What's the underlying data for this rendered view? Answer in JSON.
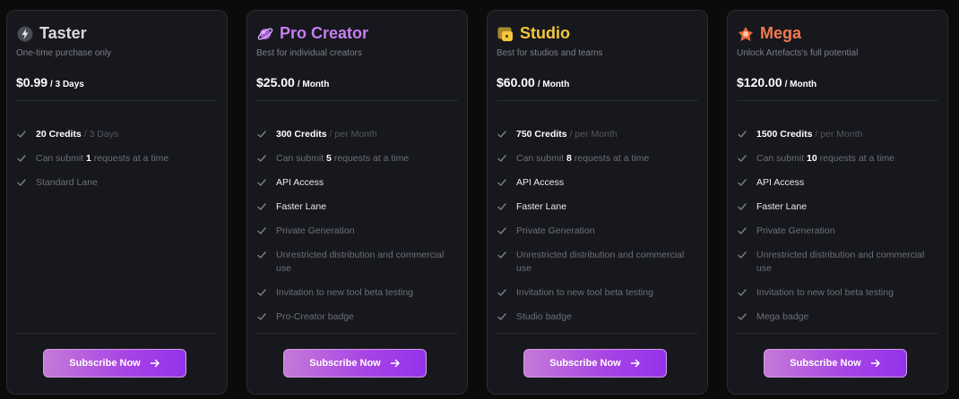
{
  "plans": [
    {
      "name": "Taster",
      "color": "#d8d9dd",
      "icon": "lightning-icon",
      "subtitle": "One-time purchase only",
      "price": "$0.99",
      "period": "/ 3 Days",
      "cta": "Subscribe Now",
      "features": [
        {
          "pre": "",
          "strong": "20 Credits",
          "post": "",
          "muted": " / 3 Days",
          "bright": true
        },
        {
          "pre": "Can submit ",
          "strong": "1",
          "post": " requests at a time",
          "muted": "",
          "bright": false
        },
        {
          "pre": "Standard Lane",
          "strong": "",
          "post": "",
          "muted": "",
          "bright": false
        }
      ]
    },
    {
      "name": "Pro Creator",
      "color": "#c77df0",
      "icon": "planet-icon",
      "subtitle": "Best for individual creators",
      "price": "$25.00",
      "period": "/ Month",
      "cta": "Subscribe Now",
      "features": [
        {
          "pre": "",
          "strong": "300 Credits",
          "post": "",
          "muted": " / per Month",
          "bright": true
        },
        {
          "pre": "Can submit ",
          "strong": "5",
          "post": " requests at a time",
          "muted": "",
          "bright": false
        },
        {
          "pre": "API Access",
          "strong": "",
          "post": "",
          "muted": "",
          "bright": true
        },
        {
          "pre": "Faster Lane",
          "strong": "",
          "post": "",
          "muted": "",
          "bright": true
        },
        {
          "pre": "Private Generation",
          "strong": "",
          "post": "",
          "muted": "",
          "bright": false
        },
        {
          "pre": "Unrestricted distribution and commercial use",
          "strong": "",
          "post": "",
          "muted": "",
          "bright": false
        },
        {
          "pre": "Invitation to new tool beta testing",
          "strong": "",
          "post": "",
          "muted": "",
          "bright": false
        },
        {
          "pre": "Pro-Creator badge",
          "strong": "",
          "post": "",
          "muted": "",
          "bright": false
        }
      ]
    },
    {
      "name": "Studio",
      "color": "#f5c73b",
      "icon": "studio-icon",
      "subtitle": "Best for studios and teams",
      "price": "$60.00",
      "period": "/ Month",
      "cta": "Subscribe Now",
      "features": [
        {
          "pre": "",
          "strong": "750 Credits",
          "post": "",
          "muted": " / per Month",
          "bright": true
        },
        {
          "pre": "Can submit ",
          "strong": "8",
          "post": " requests at a time",
          "muted": "",
          "bright": false
        },
        {
          "pre": "API Access",
          "strong": "",
          "post": "",
          "muted": "",
          "bright": true
        },
        {
          "pre": "Faster Lane",
          "strong": "",
          "post": "",
          "muted": "",
          "bright": true
        },
        {
          "pre": "Private Generation",
          "strong": "",
          "post": "",
          "muted": "",
          "bright": false
        },
        {
          "pre": "Unrestricted distribution and commercial use",
          "strong": "",
          "post": "",
          "muted": "",
          "bright": false
        },
        {
          "pre": "Invitation to new tool beta testing",
          "strong": "",
          "post": "",
          "muted": "",
          "bright": false
        },
        {
          "pre": "Studio badge",
          "strong": "",
          "post": "",
          "muted": "",
          "bright": false
        }
      ]
    },
    {
      "name": "Mega",
      "color": "#f47a4e",
      "icon": "mega-icon",
      "subtitle": "Unlock Artefacts's full potential",
      "price": "$120.00",
      "period": "/ Month",
      "cta": "Subscribe Now",
      "features": [
        {
          "pre": "",
          "strong": "1500 Credits",
          "post": "",
          "muted": " / per Month",
          "bright": true
        },
        {
          "pre": "Can submit ",
          "strong": "10",
          "post": " requests at a time",
          "muted": "",
          "bright": false
        },
        {
          "pre": "API Access",
          "strong": "",
          "post": "",
          "muted": "",
          "bright": true
        },
        {
          "pre": "Faster Lane",
          "strong": "",
          "post": "",
          "muted": "",
          "bright": true
        },
        {
          "pre": "Private Generation",
          "strong": "",
          "post": "",
          "muted": "",
          "bright": false
        },
        {
          "pre": "Unrestricted distribution and commercial use",
          "strong": "",
          "post": "",
          "muted": "",
          "bright": false
        },
        {
          "pre": "Invitation to new tool beta testing",
          "strong": "",
          "post": "",
          "muted": "",
          "bright": false
        },
        {
          "pre": "Mega badge",
          "strong": "",
          "post": "",
          "muted": "",
          "bright": false
        }
      ]
    }
  ]
}
